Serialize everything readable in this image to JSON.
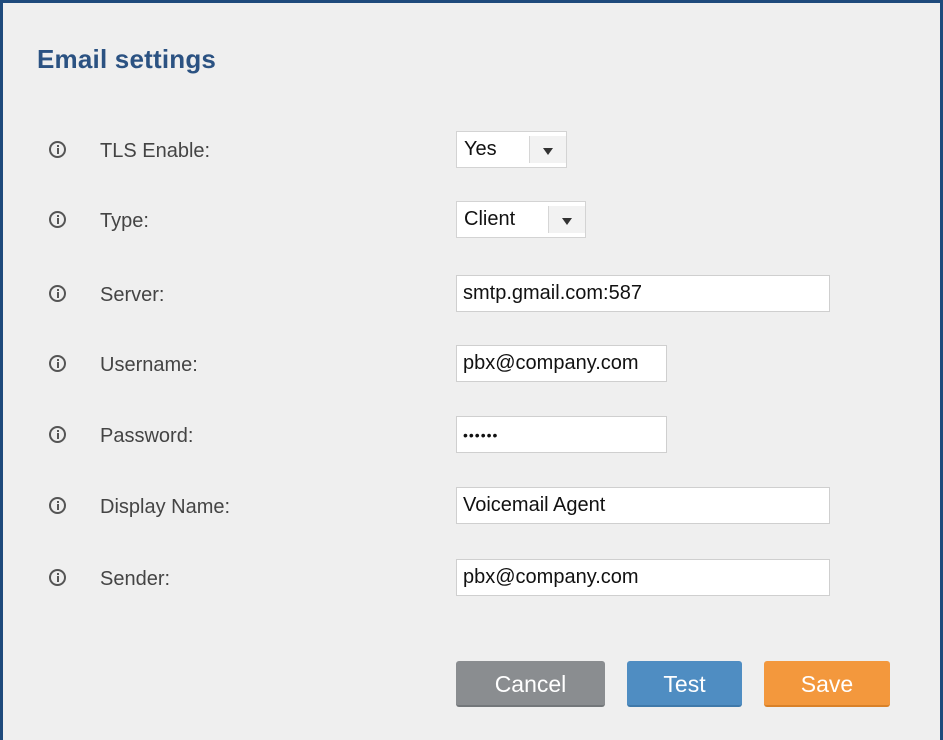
{
  "panel": {
    "title": "Email settings"
  },
  "fields": {
    "tls_enable": {
      "label": "TLS Enable:",
      "value": "Yes"
    },
    "type": {
      "label": "Type:",
      "value": "Client"
    },
    "server": {
      "label": "Server:",
      "value": "smtp.gmail.com:587"
    },
    "username": {
      "label": "Username:",
      "value": "pbx@company.com"
    },
    "password": {
      "label": "Password:",
      "value": "••••••"
    },
    "display_name": {
      "label": "Display Name:",
      "value": "Voicemail Agent"
    },
    "sender": {
      "label": "Sender:",
      "value": "pbx@company.com"
    }
  },
  "icons": {
    "info": "info-icon",
    "dropdown": "chevron-down-icon"
  },
  "actions": {
    "cancel_label": "Cancel",
    "test_label": "Test",
    "save_label": "Save"
  },
  "colors": {
    "title": "#2b5282",
    "border": "#1e4a7c",
    "cancel": "#8a8d90",
    "test": "#4f8dc2",
    "save": "#f3983d"
  }
}
